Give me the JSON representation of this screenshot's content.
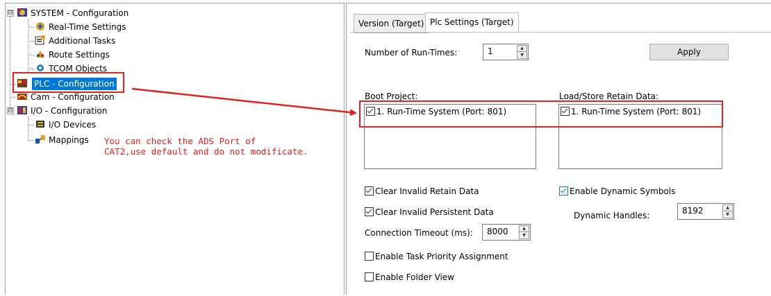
{
  "tree": {
    "items": [
      {
        "label": "SYSTEM - Configuration",
        "icon": "system-icon"
      },
      {
        "label": "Real-Time Settings",
        "icon": "realtime-icon"
      },
      {
        "label": "Additional Tasks",
        "icon": "tasks-icon"
      },
      {
        "label": "Route Settings",
        "icon": "route-icon"
      },
      {
        "label": "TCOM Objects",
        "icon": "tcom-icon"
      },
      {
        "label": "PLC - Configuration",
        "icon": "plc-icon"
      },
      {
        "label": "Cam - Configuration",
        "icon": "cam-icon"
      },
      {
        "label": "I/O - Configuration",
        "icon": "io-icon"
      },
      {
        "label": "I/O Devices",
        "icon": "io-devices-icon"
      },
      {
        "label": "Mappings",
        "icon": "mappings-icon"
      }
    ],
    "expander_minus": "⊟",
    "expander_plus": "⊞"
  },
  "note": "You can check the ADS Port of\nCAT2,use default and do not modificate.",
  "tabs": [
    "Version (Target)",
    "Plc Settings (Target)"
  ],
  "settings": {
    "runtimes_label": "Number of Run-Times:",
    "runtimes_value": "1",
    "apply_label": "Apply",
    "boot_project_label": "Boot Project:",
    "boot_project_item": "1. Run-Time System (Port: 801)",
    "retain_label": "Load/Store Retain Data:",
    "retain_item": "1. Run-Time System (Port: 801)",
    "clear_retain": "Clear Invalid Retain Data",
    "clear_persistent": "Clear Invalid Persistent Data",
    "connection_timeout_label": "Connection Timeout (ms):",
    "connection_timeout_value": "8000",
    "enable_task_priority": "Enable Task Priority Assignment",
    "enable_folder_view": "Enable Folder View",
    "enable_dynamic_symbols": "Enable Dynamic Symbols",
    "dynamic_handles_label": "Dynamic Handles:",
    "dynamic_handles_value": "8192"
  },
  "colors": {
    "annotation": "#e0211d",
    "selection": "#0078d7"
  }
}
